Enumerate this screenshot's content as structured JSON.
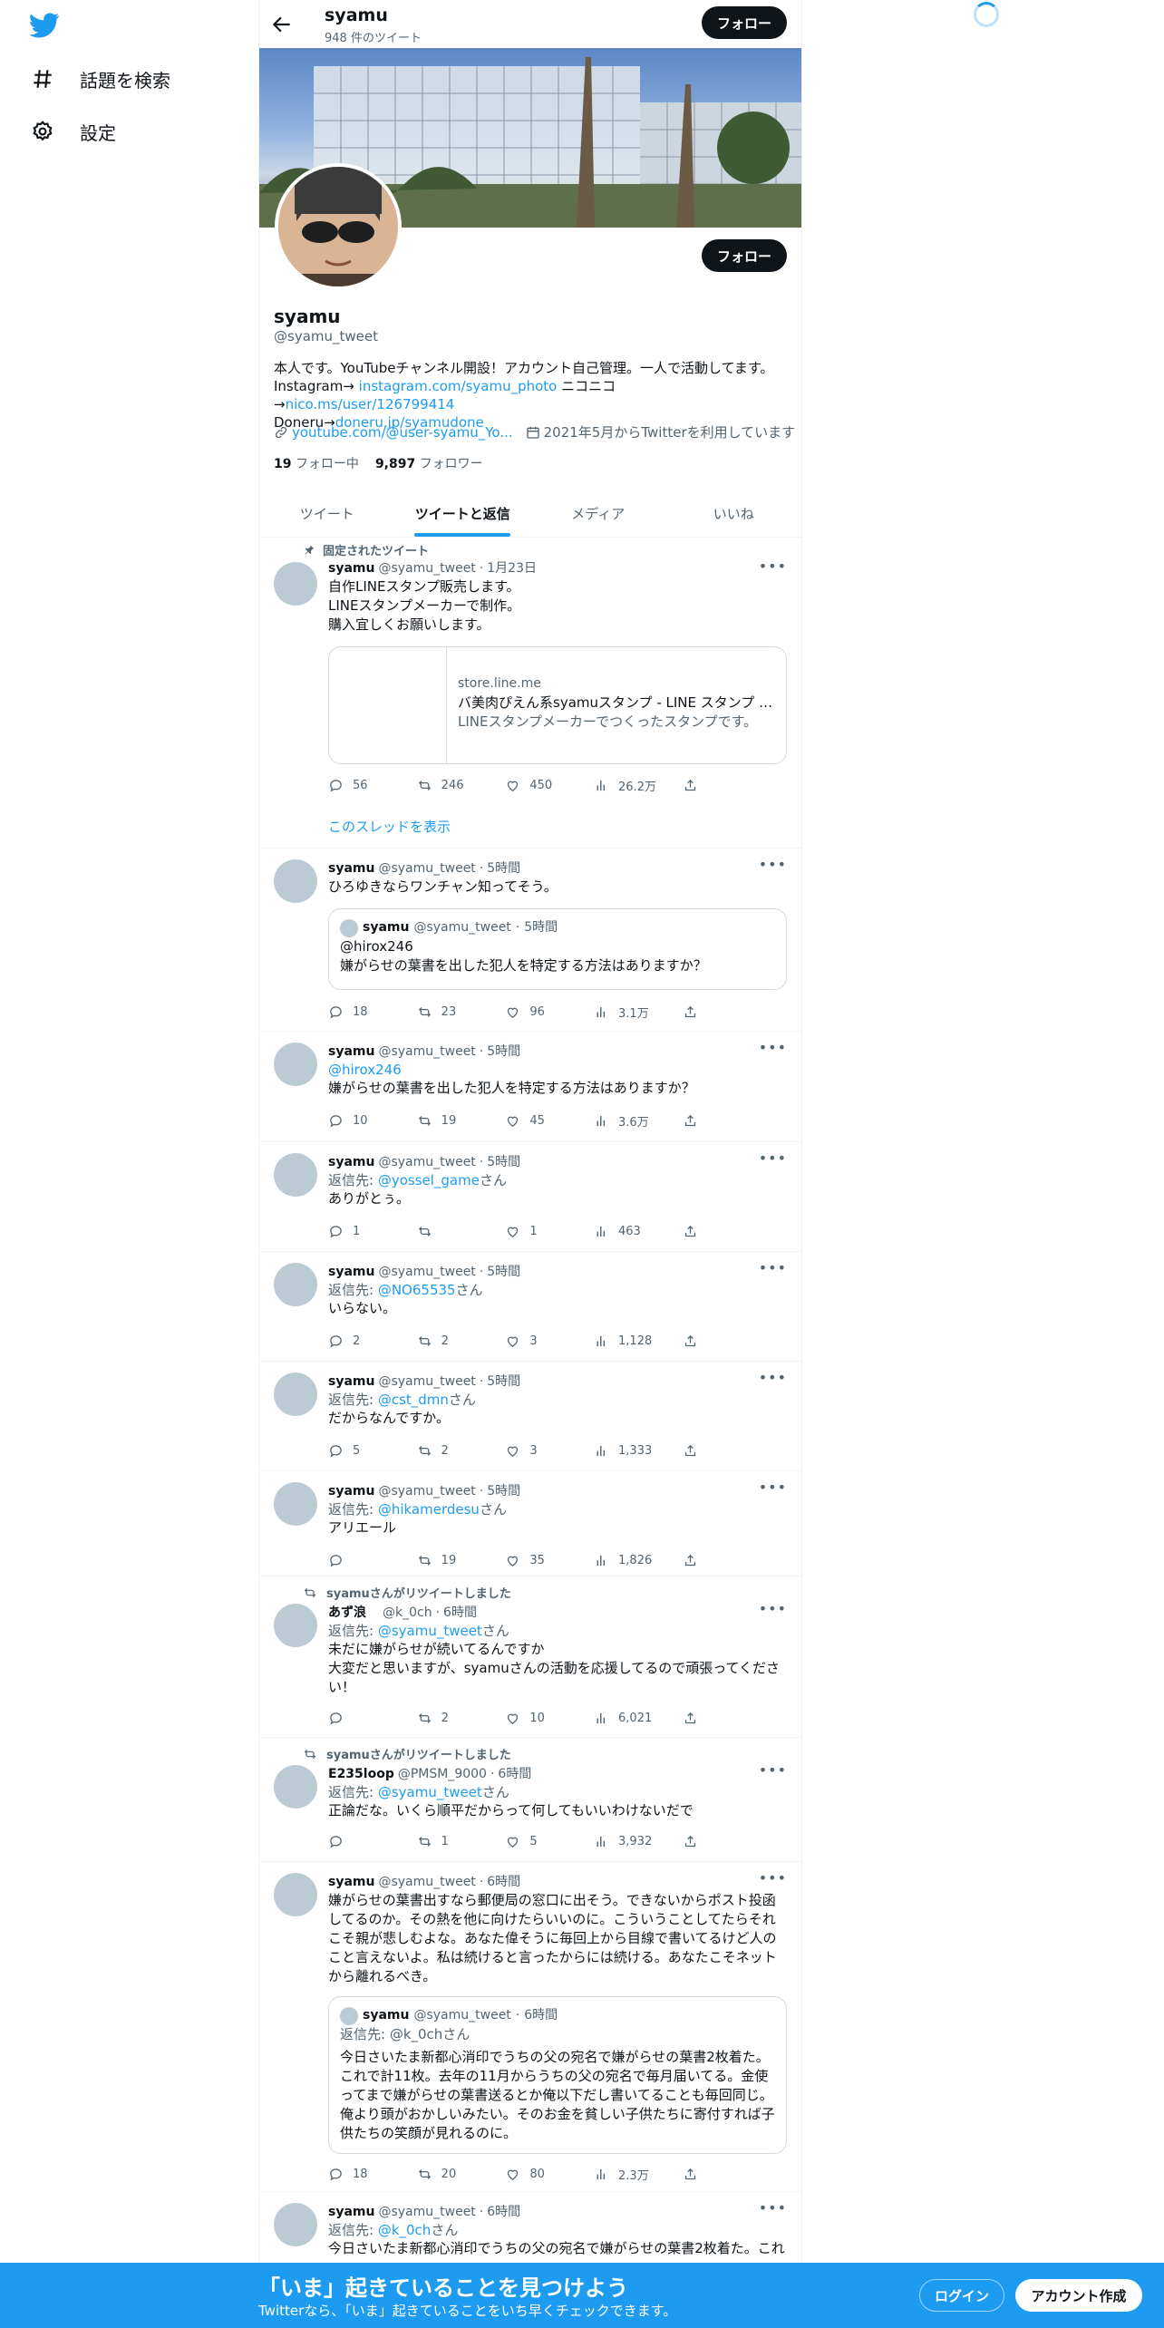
{
  "nav": {
    "explore": "話題を検索",
    "settings": "設定"
  },
  "header": {
    "name": "syamu",
    "tweet_count": "948 件のツイート",
    "follow": "フォロー"
  },
  "profile": {
    "follow": "フォロー",
    "name": "syamu",
    "handle": "@syamu_tweet",
    "bio_line1": "本人です。YouTubeチャンネル開設！アカウント自己管理。一人で活動してます。",
    "bio_instagram_label": "Instagram→ ",
    "bio_instagram_link": "instagram.com/syamu_photo",
    "bio_nico_label": " ニコニコ→",
    "bio_nico_link": "nico.ms/user/126799414",
    "bio_doneru_label": "Doneru→",
    "bio_doneru_link": "doneru.jp/syamudone",
    "website": "youtube.com/@user-syamu_Yo...",
    "joined": "2021年5月からTwitterを利用しています",
    "following_count": "19",
    "following_label": "フォロー中",
    "followers_count": "9,897",
    "followers_label": "フォロワー"
  },
  "tabs": [
    "ツイート",
    "ツイートと返信",
    "メディア",
    "いいね"
  ],
  "tweets": [
    {
      "pinned": "固定されたツイート",
      "name": "syamu",
      "handle": "@syamu_tweet",
      "time": "1月23日",
      "text": "自作LINEスタンプ販売します。\nLINEスタンプメーカーで制作。\n購入宜しくお願いします。",
      "card_domain": "store.line.me",
      "card_title": "バ美肉ぴえん系syamuスタンプ - LINE スタンプ | ...",
      "card_desc": "LINEスタンプメーカーでつくったスタンプです。",
      "replies": "56",
      "retweets": "246",
      "likes": "450",
      "views": "26.2万",
      "thread": "このスレッドを表示"
    },
    {
      "name": "syamu",
      "handle": "@syamu_tweet",
      "time": "5時間",
      "text": "ひろゆきならワンチャン知ってそう。",
      "quote_name": "syamu",
      "quote_handle": "@syamu_tweet",
      "quote_time": "5時間",
      "quote_text": "@hirox246\n嫌がらせの葉書を出した犯人を特定する方法はありますか？",
      "replies": "18",
      "retweets": "23",
      "likes": "96",
      "views": "3.1万"
    },
    {
      "name": "syamu",
      "handle": "@syamu_tweet",
      "time": "5時間",
      "mention": "@hirox246",
      "text": "嫌がらせの葉書を出した犯人を特定する方法はありますか？",
      "replies": "10",
      "retweets": "19",
      "likes": "45",
      "views": "3.6万"
    },
    {
      "name": "syamu",
      "handle": "@syamu_tweet",
      "time": "5時間",
      "reply_prefix": "返信先: ",
      "reply_to": "@yossel_game",
      "reply_suffix": "さん",
      "text": "ありがとぅ。",
      "replies": "1",
      "retweets": "",
      "likes": "1",
      "views": "463"
    },
    {
      "name": "syamu",
      "handle": "@syamu_tweet",
      "time": "5時間",
      "reply_prefix": "返信先: ",
      "reply_to": "@NO65535",
      "reply_suffix": "さん",
      "text": "いらない。",
      "replies": "2",
      "retweets": "2",
      "likes": "3",
      "views": "1,128"
    },
    {
      "name": "syamu",
      "handle": "@syamu_tweet",
      "time": "5時間",
      "reply_prefix": "返信先: ",
      "reply_to": "@cst_dmn",
      "reply_suffix": "さん",
      "text": "だからなんですか。",
      "replies": "5",
      "retweets": "2",
      "likes": "3",
      "views": "1,333"
    },
    {
      "name": "syamu",
      "handle": "@syamu_tweet",
      "time": "5時間",
      "reply_prefix": "返信先: ",
      "reply_to": "@hikamerdesu",
      "reply_suffix": "さん",
      "text": "アリエール",
      "replies": "",
      "retweets": "19",
      "likes": "35",
      "views": "1,826"
    },
    {
      "retweeted_by": "syamuさんがリツイートしました",
      "name": "あず浪",
      "handle": "@k_0ch",
      "time": "6時間",
      "reply_prefix": "返信先: ",
      "reply_to": "@syamu_tweet",
      "reply_suffix": "さん",
      "text": "未だに嫌がらせが続いてるんですか\n大変だと思いますが、syamuさんの活動を応援してるので頑張ってください！",
      "replies": "",
      "retweets": "2",
      "likes": "10",
      "views": "6,021"
    },
    {
      "retweeted_by": "syamuさんがリツイートしました",
      "name": "E235loop",
      "handle": "@PMSM_9000",
      "time": "6時間",
      "reply_prefix": "返信先: ",
      "reply_to": "@syamu_tweet",
      "reply_suffix": "さん",
      "text": "正論だな。いくら順平だからって何してもいいわけないだで",
      "replies": "",
      "retweets": "1",
      "likes": "5",
      "views": "3,932"
    },
    {
      "name": "syamu",
      "handle": "@syamu_tweet",
      "time": "6時間",
      "text": "嫌がらせの葉書出すなら郵便局の窓口に出そう。できないからポスト投函してるのか。その熱を他に向けたらいいのに。こういうことしてたらそれこそ親が悲しむよな。あなた偉そうに毎回上から目線で書いてるけど人のこと言えないよ。私は続けると言ったからには続ける。あなたこそネットから離れるべき。",
      "quote_name": "syamu",
      "quote_handle": "@syamu_tweet",
      "quote_time": "6時間",
      "quote_reply": "返信先: @k_0chさん",
      "quote_text": "今日さいたま新都心消印でうちの父の宛名で嫌がらせの葉書2枚着た。これで計11枚。去年の11月からうちの父の宛名で毎月届いてる。金使ってまで嫌がらせの葉書送るとか俺以下だし書いてることも毎回同じ。俺より頭がおかしいみたい。そのお金を貧しい子供たちに寄付すれば子供たちの笑顔が見れるのに。",
      "replies": "18",
      "retweets": "20",
      "likes": "80",
      "views": "2.3万"
    },
    {
      "name": "syamu",
      "handle": "@syamu_tweet",
      "time": "6時間",
      "reply_prefix": "返信先: ",
      "reply_to": "@k_0ch",
      "reply_suffix": "さん",
      "text": "今日さいたま新都心消印でうちの父の宛名で嫌がらせの葉書2枚着た。これ"
    }
  ],
  "bottom": {
    "title": "「いま」起きていることを見つけよう",
    "subtitle": "Twitterなら、「いま」起きていることをいち早くチェックできます。",
    "login": "ログイン",
    "signup": "アカウント作成"
  }
}
